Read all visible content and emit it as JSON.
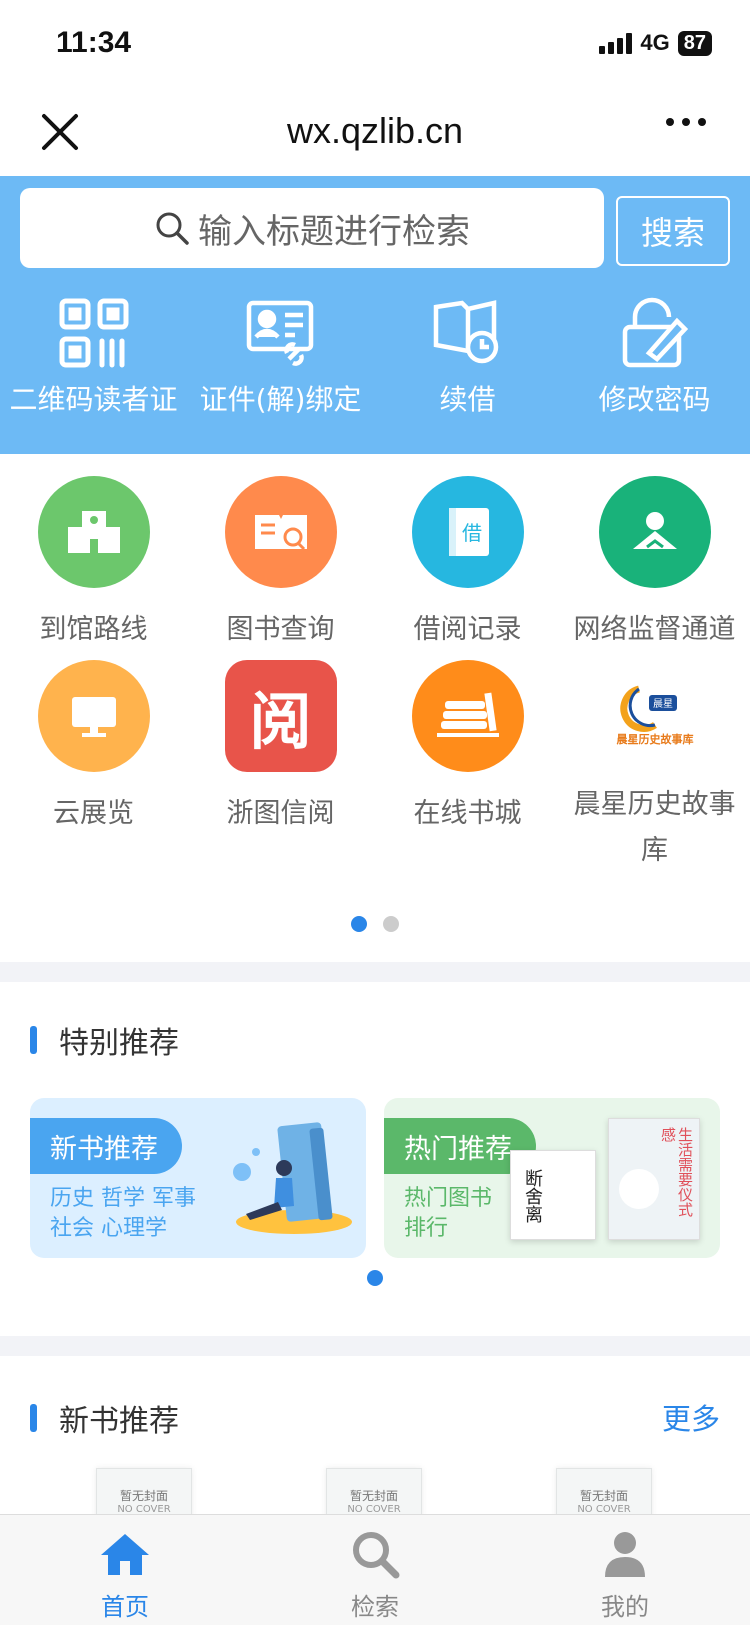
{
  "status": {
    "time": "11:34",
    "network": "4G",
    "battery": "87"
  },
  "nav": {
    "title": "wx.qzlib.cn"
  },
  "search": {
    "placeholder": "输入标题进行检索",
    "button_label": "搜索"
  },
  "quick_actions": [
    {
      "label": "二维码读者证",
      "icon": "qr-code-icon"
    },
    {
      "label": "证件(解)绑定",
      "icon": "id-card-link-icon"
    },
    {
      "label": "续借",
      "icon": "book-clock-icon"
    },
    {
      "label": "修改密码",
      "icon": "lock-edit-icon"
    }
  ],
  "grid": [
    {
      "label": "到馆路线",
      "icon": "building-icon",
      "color": "#6cc76c"
    },
    {
      "label": "图书查询",
      "icon": "book-search-icon",
      "color": "#ff8a4c"
    },
    {
      "label": "借阅记录",
      "icon": "borrow-book-icon",
      "color": "#26b7e0"
    },
    {
      "label": "网络监督通道",
      "icon": "person-book-icon",
      "color": "#19b27a"
    },
    {
      "label": "云展览",
      "icon": "monitor-icon",
      "color": "#ffb34d"
    },
    {
      "label": "浙图信阅",
      "icon": "read-app-icon",
      "color": "#e8544a",
      "glyph": "阅"
    },
    {
      "label": "在线书城",
      "icon": "bookshelf-icon",
      "color": "#ff8c1a"
    },
    {
      "label": "晨星历史故事库",
      "icon": "chenxing-logo-icon",
      "color": "#ffffff",
      "logo_text": "晨星",
      "logo_sub": "晨星历史故事库"
    }
  ],
  "grid_pages": {
    "total": 2,
    "current": 1
  },
  "special": {
    "title": "特别推荐",
    "cards": [
      {
        "tag": "新书推荐",
        "subtitle": "历史 哲学 军事 社会 心理学"
      },
      {
        "tag": "热门推荐",
        "subtitle": "热门图书排行",
        "book_titles": [
          "断舍离",
          "生活需要仪式感"
        ]
      }
    ],
    "pages": {
      "total": 1,
      "current": 1
    }
  },
  "new_books": {
    "title": "新书推荐",
    "more_label": "更多",
    "books": [
      {
        "cover_text": "暂无封面",
        "cover_sub": "NO COVER"
      },
      {
        "cover_text": "暂无封面",
        "cover_sub": "NO COVER"
      },
      {
        "cover_text": "暂无封面",
        "cover_sub": "NO COVER"
      }
    ]
  },
  "tabs": [
    {
      "label": "首页",
      "icon": "home-icon",
      "active": true
    },
    {
      "label": "检索",
      "icon": "search-icon",
      "active": false
    },
    {
      "label": "我的",
      "icon": "user-icon",
      "active": false
    }
  ],
  "colors": {
    "accent": "#2a86e8",
    "header_blue": "#6dbaf5"
  }
}
